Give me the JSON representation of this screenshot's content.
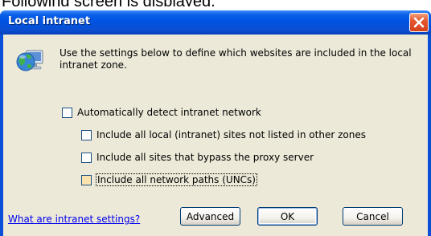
{
  "caption": "Following screen is displayed.",
  "window": {
    "title": "Local intranet"
  },
  "info": {
    "icon": "globe-computer-icon",
    "text": "Use the settings below to define which websites are included in the local intranet zone."
  },
  "options": {
    "auto_detect": {
      "label": "Automatically detect intranet network",
      "checked": false
    },
    "include_local": {
      "label": "Include all local (intranet) sites not listed in other zones",
      "checked": false
    },
    "include_bypass": {
      "label": "Include all sites that bypass the proxy server",
      "checked": false
    },
    "include_unc": {
      "label": "Include all network paths (UNCs)",
      "checked": false
    }
  },
  "footer": {
    "help_link": "What are intranet settings?",
    "advanced_label": "Advanced",
    "ok_label": "OK",
    "cancel_label": "Cancel"
  },
  "colors": {
    "titlebar": "#0054e3",
    "dialog_background": "#ece9d8",
    "link": "#0000ee"
  }
}
